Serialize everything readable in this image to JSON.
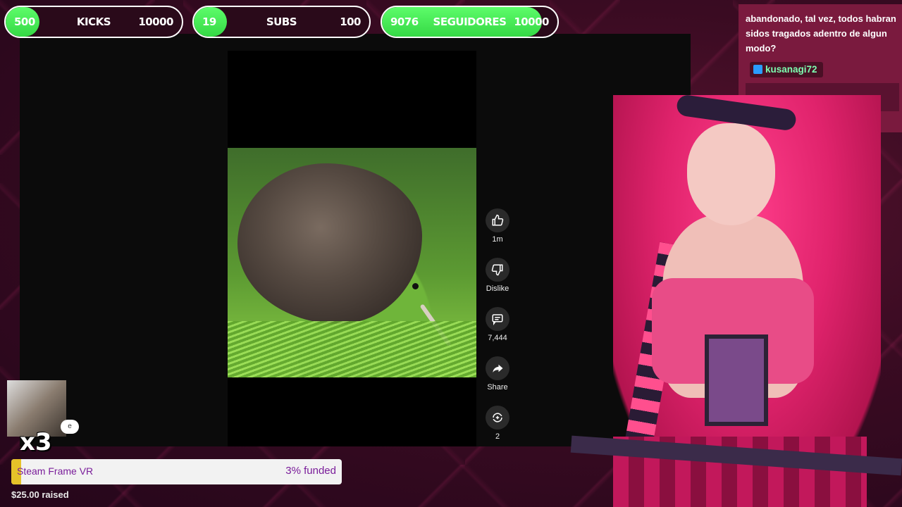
{
  "goals": [
    {
      "current": "500",
      "label": "KICKS",
      "target": "10000",
      "progress": 0.05
    },
    {
      "current": "19",
      "label": "SUBS",
      "target": "100",
      "progress": 0.19
    },
    {
      "current": "9076",
      "label": "SEGUIDORES",
      "target": "10000",
      "progress": 0.91
    }
  ],
  "video": {
    "actions": [
      {
        "icon": "thumbs-up-icon",
        "label": "1m"
      },
      {
        "icon": "thumbs-down-icon",
        "label": "Dislike"
      },
      {
        "icon": "comment-icon",
        "label": "7,444"
      },
      {
        "icon": "share-icon",
        "label": "Share"
      },
      {
        "icon": "remix-icon",
        "label": "2"
      }
    ]
  },
  "chat": {
    "message": "abandonado, tal vez, todos habran sidos tragados adentro de algun modo?",
    "username": "kusanagi72"
  },
  "emote": {
    "multiplier": "x3",
    "badge": "e"
  },
  "funding": {
    "title": "Steam Frame VR",
    "percent_label": "3% funded",
    "progress": 0.03,
    "raised": "$25.00 raised"
  },
  "colors": {
    "goal_fill": "#35d945",
    "chat_bg": "#7a1a3e",
    "username": "#7dffb0",
    "funding_text": "#7a1d9a"
  }
}
